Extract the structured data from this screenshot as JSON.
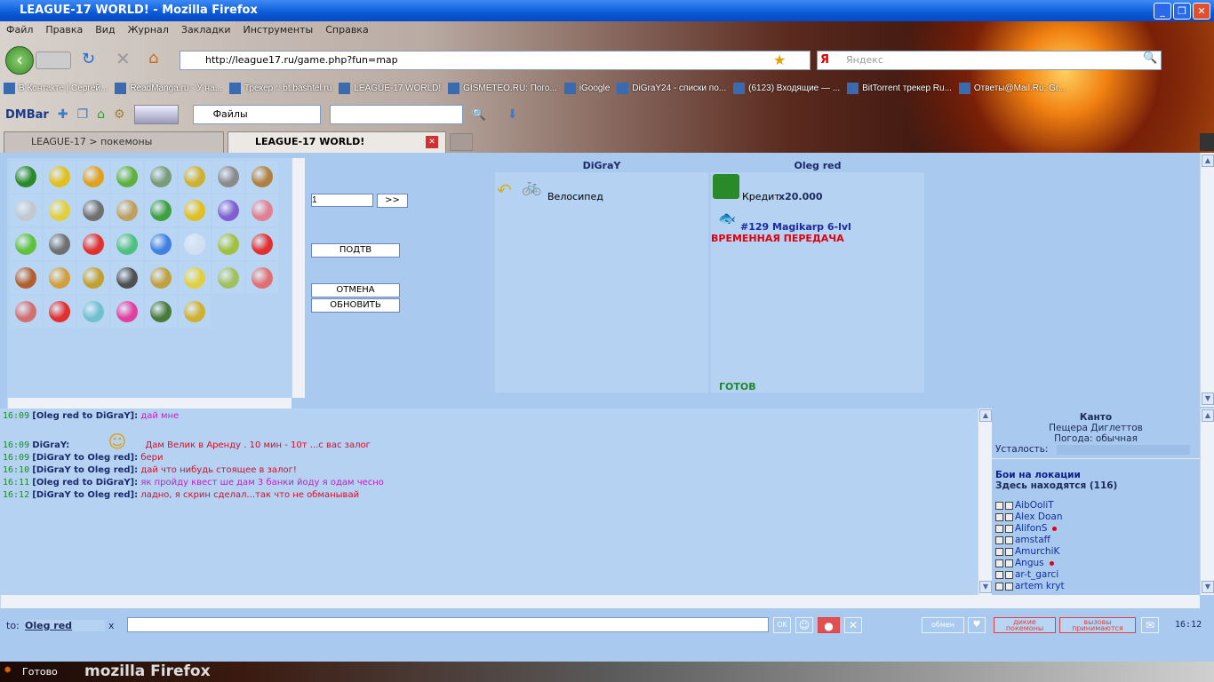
{
  "window": {
    "title": "LEAGUE-17 WORLD! - Mozilla Firefox"
  },
  "menu": [
    "Файл",
    "Правка",
    "Вид",
    "Журнал",
    "Закладки",
    "Инструменты",
    "Справка"
  ],
  "nav": {
    "url": "http://league17.ru/game.php?fun=map",
    "search_engine": "Я",
    "search_placeholder": "Яндекс"
  },
  "bookmarks": [
    "В Контакте | Сергей...",
    "ReadManga.ru - У на...",
    "Трекер :: bt.bashtel.ru",
    "LEAGUE-17 WORLD!",
    "GISMETEO.RU: Пого...",
    "iGoogle",
    "DiGraY24 - списки по...",
    "(6123) Входящие — ...",
    "BitTorrent трекер Ru...",
    "Ответы@Mail.Ru: Gr..."
  ],
  "dmbar": {
    "label": "DMBar",
    "dropdown": "Файлы"
  },
  "tabs": [
    {
      "label": "LEAGUE-17 > покемоны"
    },
    {
      "label": "LEAGUE-17 WORLD!"
    }
  ],
  "items_colors": [
    "#2a8a2a",
    "#e0c020",
    "#e0a020",
    "#60b040",
    "#7a9a7a",
    "#d0b030",
    "#8a8a8a",
    "#b08040",
    "#c0c8d0",
    "#e0d040",
    "#707070",
    "#c0a060",
    "#40a040",
    "#e0c020",
    "#8060d0",
    "#e08090",
    "#60c040",
    "#707070",
    "#e03030",
    "#50c080",
    "#4080e0",
    "#d0e0f0",
    "#a0c040",
    "#e03030",
    "#b06030",
    "#d0a040",
    "#c0a030",
    "#505050",
    "#c0a040",
    "#e0d040",
    "#a0c060",
    "#e07070",
    "#d07070",
    "#e03030",
    "#70c0d0",
    "#e040a0",
    "#4a7a3a",
    "#d0b030"
  ],
  "controls": {
    "qty": "1",
    "next": ">>",
    "confirm": "ПОДТВ",
    "cancel": "ОТМЕНА",
    "refresh": "ОБНОВИТЬ"
  },
  "trade_left": {
    "name": "DiGraY",
    "item": "Велосипед"
  },
  "trade_right": {
    "name": "Oleg red",
    "credit_label": "Кредит",
    "credit_amount": "x20.000",
    "pokemon": "#129 Magikarp 6-lvl",
    "temp": "ВРЕМЕННАЯ ПЕРЕДАЧА",
    "ready": "ГОТОВ"
  },
  "chat": [
    {
      "time": "16:09",
      "who": "[Oleg red to DiGraY]:",
      "msg": "дай мне",
      "c": "m1"
    },
    {
      "time": "16:09",
      "who": "DiGraY:",
      "msg": "Дам Велик в Аренду . 10 мин - 10т ...с вас залог",
      "c": "m2"
    },
    {
      "time": "16:09",
      "who": "[DiGraY to Oleg red]:",
      "msg": "бери",
      "c": "m2"
    },
    {
      "time": "16:10",
      "who": "[DiGraY to Oleg red]:",
      "msg": "дай что нибудь стоящее в залог!",
      "c": "m2"
    },
    {
      "time": "16:11",
      "who": "[Oleg red to DiGraY]:",
      "msg": "як пройду квест ше дам 3 банки йоду я одам чесно",
      "c": "m1"
    },
    {
      "time": "16:12",
      "who": "[DiGraY to Oleg red]:",
      "msg": "ладно, я скрин сделал...так что не обманывай",
      "c": "m2"
    }
  ],
  "location": {
    "region": "Канто",
    "place": "Пещера Диглеттов",
    "weather": "Погода: обычная",
    "fatigue": "Усталость:",
    "battles": "Бои на локации",
    "here": "Здесь находятся (116)",
    "users": [
      {
        "n": "AibOoliT",
        "d": false
      },
      {
        "n": "Alex Doan",
        "d": false
      },
      {
        "n": "AlifonS",
        "d": true
      },
      {
        "n": "amstaff",
        "d": false
      },
      {
        "n": "AmurchiK",
        "d": false
      },
      {
        "n": "Angus",
        "d": true
      },
      {
        "n": "ar-t_garci",
        "d": false
      },
      {
        "n": "artem kryt",
        "d": false
      }
    ]
  },
  "bottom": {
    "to_label": "to:",
    "to_name": "Oleg red",
    "x": "x",
    "ok": "OK",
    "exchange": "обмен",
    "wild": "дикие покемоны",
    "calls": "вызовы принимаются",
    "clock": "16:12"
  },
  "status": {
    "text": "Готово",
    "brand": "mozilla Firefox"
  }
}
